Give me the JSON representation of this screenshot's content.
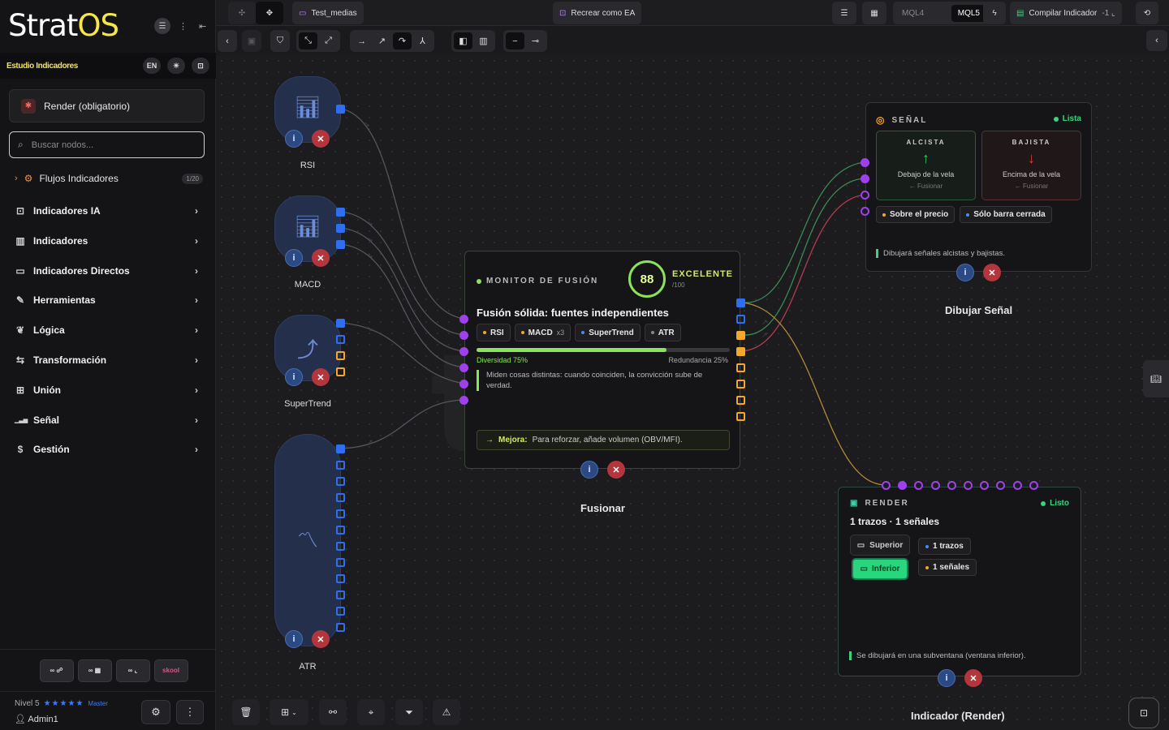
{
  "brand": {
    "name_main": "Strat",
    "name_accent": "OS"
  },
  "studio": {
    "label": "Estudio Indicadores",
    "lang": "EN"
  },
  "render_button": {
    "label": "Render (obligatorio)"
  },
  "search": {
    "placeholder": "Buscar nodos..."
  },
  "flows": {
    "label": "Flujos Indicadores",
    "count": "1/20"
  },
  "categories": [
    {
      "label": "Indicadores IA",
      "icon": "robot-icon"
    },
    {
      "label": "Indicadores",
      "icon": "bar-chart-icon"
    },
    {
      "label": "Indicadores Directos",
      "icon": "monitor-icon"
    },
    {
      "label": "Herramientas",
      "icon": "pen-icon"
    },
    {
      "label": "Lógica",
      "icon": "brain-icon"
    },
    {
      "label": "Transformación",
      "icon": "transform-icon"
    },
    {
      "label": "Unión",
      "icon": "union-icon"
    },
    {
      "label": "Señal",
      "icon": "signal-icon"
    },
    {
      "label": "Gestión",
      "icon": "dollar-icon"
    }
  ],
  "bottom_links": {
    "skool": "skool"
  },
  "user": {
    "level": "Nivel 5",
    "rank": "Master",
    "name": "Admin1",
    "stars": "★★★★★"
  },
  "topbar": {
    "project": "Test_medias",
    "recreate": "Recrear como EA",
    "mql4": "MQL4",
    "mql5": "MQL5",
    "compile": "Compilar Indicador"
  },
  "nodes": {
    "rsi": "RSI",
    "macd": "MACD",
    "supertrend": "SuperTrend",
    "atr": "ATR"
  },
  "fusion": {
    "header": "MONITOR DE FUSIÓN",
    "score": "88",
    "grade": "EXCELENTE",
    "grade_sub": "/100",
    "title": "Fusión sólida: fuentes independientes",
    "chips": [
      {
        "label": "RSI",
        "color": "#f2a72e",
        "extra": ""
      },
      {
        "label": "MACD",
        "color": "#f2a72e",
        "extra": "x3"
      },
      {
        "label": "SuperTrend",
        "color": "#4a8bf5",
        "extra": ""
      },
      {
        "label": "ATR",
        "color": "#888888",
        "extra": ""
      }
    ],
    "diversity": 0.75,
    "diversity_label": "Diversidad 75%",
    "redundancy_label": "Redundancia 25%",
    "note": "Miden cosas distintas: cuando coinciden, la convicción sube de verdad.",
    "improve_label": "Mejora:",
    "improve_text": "Para reforzar, añade volumen (OBV/MFI).",
    "node_label": "Fusionar"
  },
  "signal": {
    "header": "SEÑAL",
    "status": "Lista",
    "bull_title": "ALCISTA",
    "bull_desc": "Debajo de la vela",
    "bull_sub": "← Fusionar",
    "bear_title": "BAJISTA",
    "bear_desc": "Encima de la vela",
    "bear_sub": "← Fusionar",
    "tag1": "Sobre el precio",
    "tag2": "Sólo barra cerrada",
    "note": "Dibujará señales alcistas y bajistas.",
    "node_label": "Dibujar Señal"
  },
  "render": {
    "header": "RENDER",
    "status": "Listo",
    "title": "1 trazos · 1 señales",
    "btn_top": "Superior",
    "btn_bottom": "Inferior",
    "tag1": "1 trazos",
    "tag2": "1 señales",
    "note": "Se dibujará en una subventana (ventana inferior).",
    "node_label": "Indicador (Render)"
  },
  "colors": {
    "accent": "#f5e64a",
    "green": "#8ae35a",
    "blue": "#2e6ff2",
    "orange": "#f2a72e",
    "purple": "#a040ea",
    "red": "#b3363d"
  }
}
